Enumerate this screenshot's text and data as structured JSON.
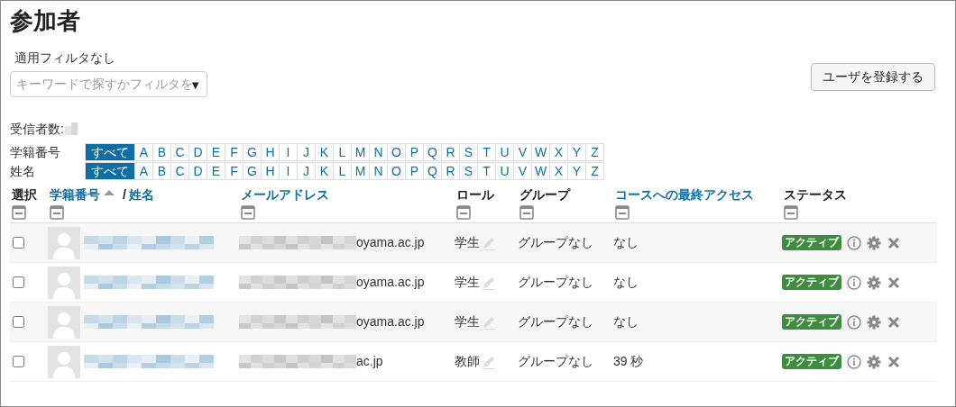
{
  "title": "参加者",
  "filter_status": "適用フィルタなし",
  "search": {
    "placeholder": "キーワードで探すかフィルタを",
    "arrow": "▼"
  },
  "enrol_button": "ユーザを登録する",
  "recipients_label": "受信者数:",
  "initials_bars": [
    {
      "label": "学籍番号",
      "items": [
        {
          "text": "すべて",
          "selected": true
        },
        {
          "text": "A",
          "selected": false
        },
        {
          "text": "B",
          "selected": false
        },
        {
          "text": "C",
          "selected": false
        },
        {
          "text": "D",
          "selected": false
        },
        {
          "text": "E",
          "selected": false
        },
        {
          "text": "F",
          "selected": false
        },
        {
          "text": "G",
          "selected": false
        },
        {
          "text": "H",
          "selected": false
        },
        {
          "text": "I",
          "selected": false
        },
        {
          "text": "J",
          "selected": false
        },
        {
          "text": "K",
          "selected": false
        },
        {
          "text": "L",
          "selected": false
        },
        {
          "text": "M",
          "selected": false
        },
        {
          "text": "N",
          "selected": false
        },
        {
          "text": "O",
          "selected": false
        },
        {
          "text": "P",
          "selected": false
        },
        {
          "text": "Q",
          "selected": false
        },
        {
          "text": "R",
          "selected": false
        },
        {
          "text": "S",
          "selected": false
        },
        {
          "text": "T",
          "selected": false
        },
        {
          "text": "U",
          "selected": false
        },
        {
          "text": "V",
          "selected": false
        },
        {
          "text": "W",
          "selected": false
        },
        {
          "text": "X",
          "selected": false
        },
        {
          "text": "Y",
          "selected": false
        },
        {
          "text": "Z",
          "selected": false
        }
      ]
    },
    {
      "label": "姓名",
      "items": [
        {
          "text": "すべて",
          "selected": true
        },
        {
          "text": "A",
          "selected": false
        },
        {
          "text": "B",
          "selected": false
        },
        {
          "text": "C",
          "selected": false
        },
        {
          "text": "D",
          "selected": false
        },
        {
          "text": "E",
          "selected": false
        },
        {
          "text": "F",
          "selected": false
        },
        {
          "text": "G",
          "selected": false
        },
        {
          "text": "H",
          "selected": false
        },
        {
          "text": "I",
          "selected": false
        },
        {
          "text": "J",
          "selected": false
        },
        {
          "text": "K",
          "selected": false
        },
        {
          "text": "L",
          "selected": false
        },
        {
          "text": "M",
          "selected": false
        },
        {
          "text": "N",
          "selected": false
        },
        {
          "text": "O",
          "selected": false
        },
        {
          "text": "P",
          "selected": false
        },
        {
          "text": "Q",
          "selected": false
        },
        {
          "text": "R",
          "selected": false
        },
        {
          "text": "S",
          "selected": false
        },
        {
          "text": "T",
          "selected": false
        },
        {
          "text": "U",
          "selected": false
        },
        {
          "text": "V",
          "selected": false
        },
        {
          "text": "W",
          "selected": false
        },
        {
          "text": "X",
          "selected": false
        },
        {
          "text": "Y",
          "selected": false
        },
        {
          "text": "Z",
          "selected": false
        }
      ]
    }
  ],
  "columns": [
    {
      "label": "選択",
      "link": false
    },
    {
      "label": "学籍番号",
      "link": true,
      "sorted": true,
      "separator": "/",
      "label2": "姓名"
    },
    {
      "label": "メールアドレス",
      "link": true
    },
    {
      "label": "ロール",
      "link": false
    },
    {
      "label": "グループ",
      "link": false
    },
    {
      "label": "コースへの最終アクセス",
      "link": true
    },
    {
      "label": "ステータス",
      "link": false
    }
  ],
  "rows": [
    {
      "checked": false,
      "email_suffix": "oyama.ac.jp",
      "role": "学生",
      "group": "グループなし",
      "last_access": "なし",
      "status": "アクティブ"
    },
    {
      "checked": false,
      "email_suffix": "oyama.ac.jp",
      "role": "学生",
      "group": "グループなし",
      "last_access": "なし",
      "status": "アクティブ"
    },
    {
      "checked": false,
      "email_suffix": "oyama.ac.jp",
      "role": "学生",
      "group": "グループなし",
      "last_access": "なし",
      "status": "アクティブ"
    },
    {
      "checked": false,
      "email_suffix": "ac.jp",
      "role": "教師",
      "group": "グループなし",
      "last_access": "39 秒",
      "status": "アクティブ"
    }
  ]
}
